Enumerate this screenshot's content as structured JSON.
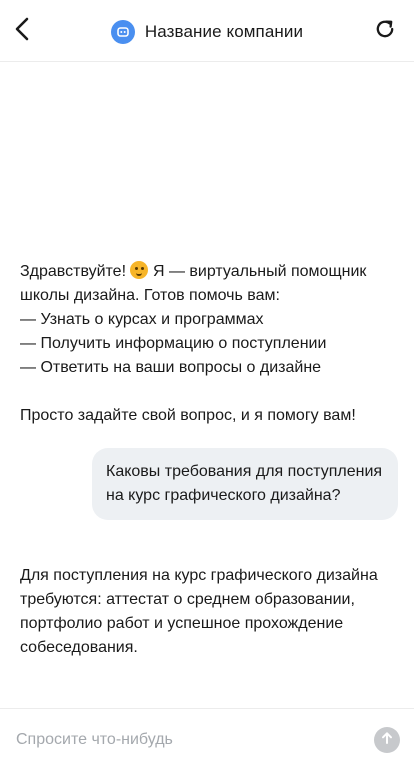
{
  "header": {
    "title": "Название компании",
    "back_icon": "chevron-left-icon",
    "bot_icon": "bot-icon",
    "refresh_icon": "refresh-icon",
    "accent_color": "#4a8ff0"
  },
  "messages": {
    "greeting": {
      "line1_before_emoji": "Здравствуйте!",
      "emoji": "hugging-face-emoji",
      "line1_after_emoji": "Я — виртуальный помощник",
      "line2": "школы дизайна. Готов помочь вам:",
      "items": [
        "— Узнать о курсах и программах",
        "— Получить информацию о поступлении",
        "— Ответить на ваши вопросы о дизайне"
      ],
      "closing": "Просто задайте свой вопрос, и я помогу вам!"
    },
    "user_question": "Каковы требования для поступления на курс графического дизайна?",
    "bot_answer": "Для поступления на курс графического дизайна требуются: аттестат о среднем образовании, портфолио работ и успешное прохождение собеседования."
  },
  "composer": {
    "placeholder": "Спросите что-нибудь",
    "value": "",
    "send_icon": "arrow-up-icon"
  },
  "colors": {
    "user_bubble": "#edf0f3",
    "send_button_disabled": "#c7c9cc",
    "placeholder": "#a4a8ad"
  }
}
